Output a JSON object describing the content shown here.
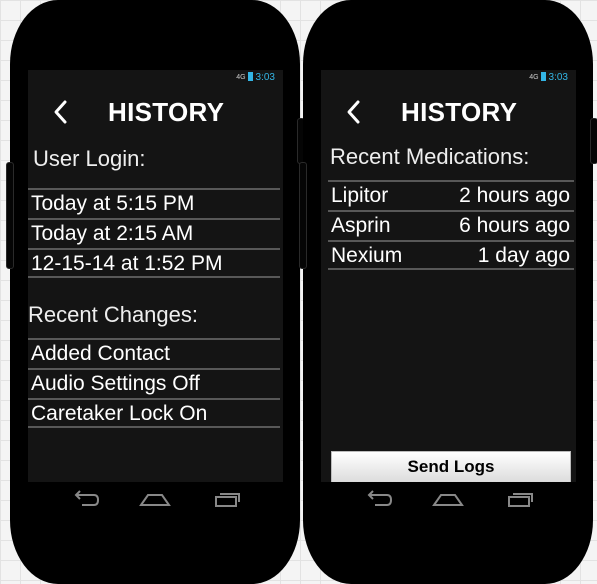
{
  "phones": [
    {
      "status": {
        "time": "3:03",
        "signal": "4G"
      },
      "title": "HISTORY",
      "user_login": {
        "label": "User Login:",
        "items": [
          "Today at 5:15 PM",
          "Today at 2:15 AM",
          "12-15-14 at 1:52 PM"
        ]
      },
      "recent_changes": {
        "label": "Recent Changes:",
        "items": [
          "Added Contact",
          "Audio Settings Off",
          "Caretaker Lock On"
        ]
      }
    },
    {
      "status": {
        "time": "3:03",
        "signal": "4G"
      },
      "title": "HISTORY",
      "recent_medications": {
        "label": "Recent Medications:",
        "items": [
          {
            "name": "Lipitor",
            "when": "2 hours ago"
          },
          {
            "name": "Asprin",
            "when": "6 hours ago"
          },
          {
            "name": "Nexium",
            "when": "1 day ago"
          }
        ]
      },
      "send_button": "Send Logs"
    }
  ],
  "icons": {
    "back": "chevron-left-icon",
    "nav_back": "back-arrow-icon",
    "nav_home": "home-icon",
    "nav_recents": "recent-apps-icon"
  },
  "colors": {
    "status_accent": "#33b5e5",
    "screen_bg": "#141414",
    "phone_body": "#000000",
    "divider": "#585858"
  }
}
